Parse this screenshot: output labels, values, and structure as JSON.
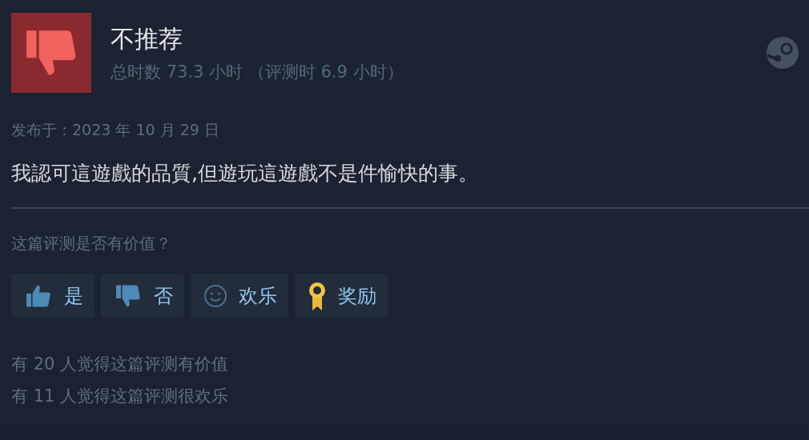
{
  "review": {
    "recommended": false,
    "verdict": "不推荐",
    "hours": "总时数 73.3 小时 （评测时 6.9 小时）",
    "posted": "发布于：2023 年 10 月 29 日",
    "text": "我認可這遊戲的品質,但遊玩這遊戲不是件愉快的事。"
  },
  "feedback": {
    "question": "这篇评测是否有价值？",
    "buttons": [
      {
        "kind": "up",
        "label": "是"
      },
      {
        "kind": "down",
        "label": "否"
      },
      {
        "kind": "funny",
        "label": "欢乐"
      },
      {
        "kind": "award",
        "label": "奖励"
      }
    ],
    "stats": [
      "有 20 人觉得这篇评测有价值",
      "有 11 人觉得这篇评测很欢乐"
    ]
  }
}
